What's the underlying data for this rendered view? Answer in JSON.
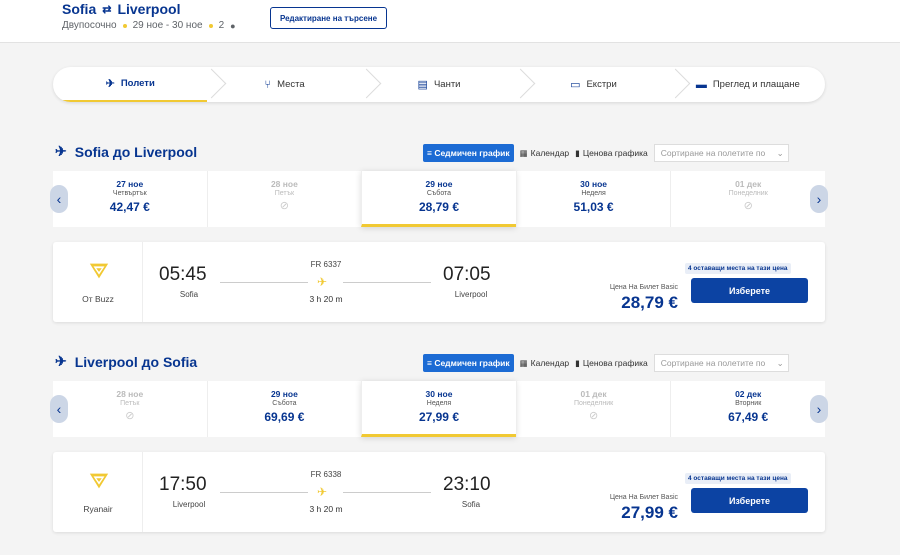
{
  "header": {
    "origin": "Sofia",
    "destination": "Liverpool",
    "trip_type": "Двупосочно",
    "dates": "29 ное - 30 ное",
    "passengers": "2",
    "edit_button": "Редактиране на търсене"
  },
  "stepper": [
    {
      "label": "Полети",
      "icon": "plane-icon"
    },
    {
      "label": "Места",
      "icon": "seat-icon"
    },
    {
      "label": "Чанти",
      "icon": "bag-icon"
    },
    {
      "label": "Екстри",
      "icon": "monitor-icon"
    },
    {
      "label": "Преглед и плащане",
      "icon": "card-icon"
    }
  ],
  "controls": {
    "weekly": "≡ Седмичен график",
    "calendar": "Календар",
    "price_chart": "Ценова графика",
    "sort_placeholder": "Сортиране на полетите по"
  },
  "outbound": {
    "title": "Sofia до Liverpool",
    "days": [
      {
        "date": "27 ное",
        "day": "Четвъртък",
        "price": "42,47 €"
      },
      {
        "date": "28 ное",
        "day": "Петък",
        "price": ""
      },
      {
        "date": "29 ное",
        "day": "Събота",
        "price": "28,79 €"
      },
      {
        "date": "30 ное",
        "day": "Неделя",
        "price": "51,03 €"
      },
      {
        "date": "01 дек",
        "day": "Понеделник",
        "price": ""
      }
    ],
    "flight": {
      "airline": "От Buzz",
      "dep_time": "05:45",
      "dep_city": "Sofia",
      "arr_time": "07:05",
      "arr_city": "Liverpool",
      "flight_no": "FR 6337",
      "duration": "3 h 20 m",
      "price_label": "Цена На Билет Basic",
      "price": "28,79 €",
      "seats_left": "4 оставащи места на тази цена",
      "select": "Изберете"
    }
  },
  "inbound": {
    "title": "Liverpool до Sofia",
    "days": [
      {
        "date": "28 ное",
        "day": "Петък",
        "price": ""
      },
      {
        "date": "29 ное",
        "day": "Събота",
        "price": "69,69 €"
      },
      {
        "date": "30 ное",
        "day": "Неделя",
        "price": "27,99 €"
      },
      {
        "date": "01 дек",
        "day": "Понеделник",
        "price": ""
      },
      {
        "date": "02 дек",
        "day": "Вторник",
        "price": "67,49 €"
      }
    ],
    "flight": {
      "airline": "Ryanair",
      "dep_time": "17:50",
      "dep_city": "Liverpool",
      "arr_time": "23:10",
      "arr_city": "Sofia",
      "flight_no": "FR 6338",
      "duration": "3 h 20 m",
      "price_label": "Цена На Билет Basic",
      "price": "27,99 €",
      "seats_left": "4 оставащи места на тази цена",
      "select": "Изберете"
    }
  }
}
